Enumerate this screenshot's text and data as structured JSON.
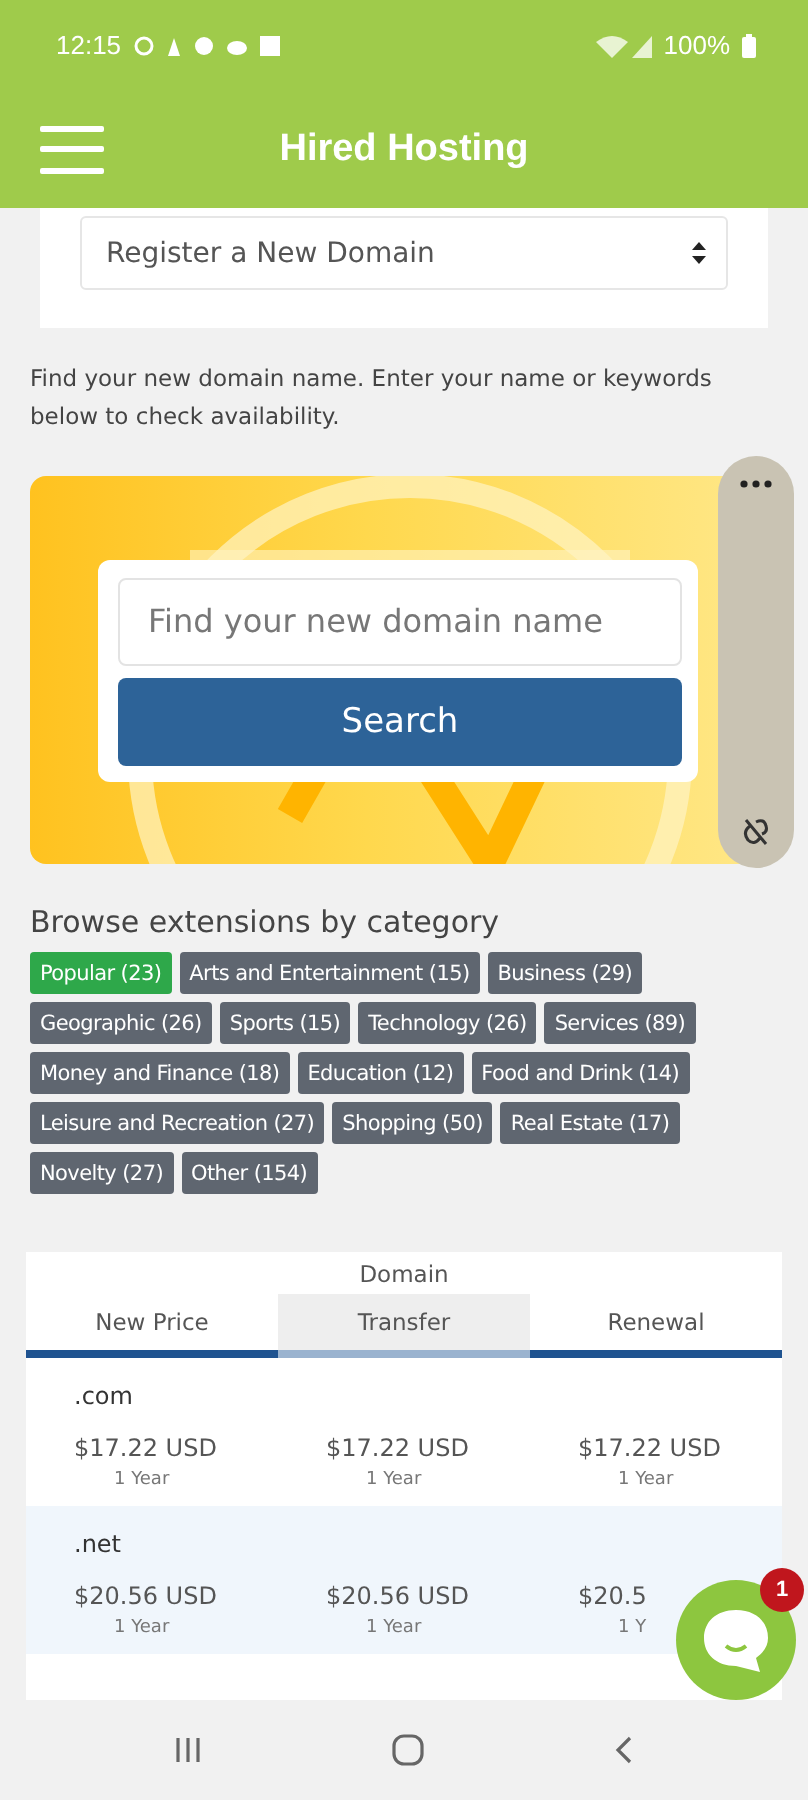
{
  "status_bar": {
    "time": "12:15",
    "battery": "100%"
  },
  "header": {
    "title": "Hired Hosting"
  },
  "domain_action": {
    "value": "Register a New Domain"
  },
  "intro": "Find your new domain name. Enter your name or keywords below to check availability.",
  "search": {
    "placeholder": "Find your new domain name",
    "button": "Search"
  },
  "categories": {
    "heading": "Browse extensions by category",
    "items": [
      {
        "label": "Popular (23)",
        "selected": true
      },
      {
        "label": "Arts and Entertainment (15)",
        "selected": false
      },
      {
        "label": "Business (29)",
        "selected": false
      },
      {
        "label": "Geographic (26)",
        "selected": false
      },
      {
        "label": "Sports (15)",
        "selected": false
      },
      {
        "label": "Technology (26)",
        "selected": false
      },
      {
        "label": "Services (89)",
        "selected": false
      },
      {
        "label": "Money and Finance (18)",
        "selected": false
      },
      {
        "label": "Education (12)",
        "selected": false
      },
      {
        "label": "Food and Drink (14)",
        "selected": false
      },
      {
        "label": "Leisure and Recreation (27)",
        "selected": false
      },
      {
        "label": "Shopping (50)",
        "selected": false
      },
      {
        "label": "Real Estate (17)",
        "selected": false
      },
      {
        "label": "Novelty (27)",
        "selected": false
      },
      {
        "label": "Other (154)",
        "selected": false
      }
    ]
  },
  "pricing": {
    "heading": "Domain",
    "tabs": [
      {
        "label": "New Price",
        "selected": false
      },
      {
        "label": "Transfer",
        "selected": true
      },
      {
        "label": "Renewal",
        "selected": false
      }
    ],
    "rows": [
      {
        "tld": ".com",
        "prices": [
          {
            "price": "$17.22 USD",
            "term": "1 Year"
          },
          {
            "price": "$17.22 USD",
            "term": "1 Year"
          },
          {
            "price": "$17.22 USD",
            "term": "1 Year"
          }
        ]
      },
      {
        "tld": ".net",
        "prices": [
          {
            "price": "$20.56 USD",
            "term": "1 Year"
          },
          {
            "price": "$20.56 USD",
            "term": "1 Year"
          },
          {
            "price": "$20.5",
            "term": "1 Y"
          }
        ]
      }
    ]
  },
  "chat": {
    "badge": "1"
  }
}
